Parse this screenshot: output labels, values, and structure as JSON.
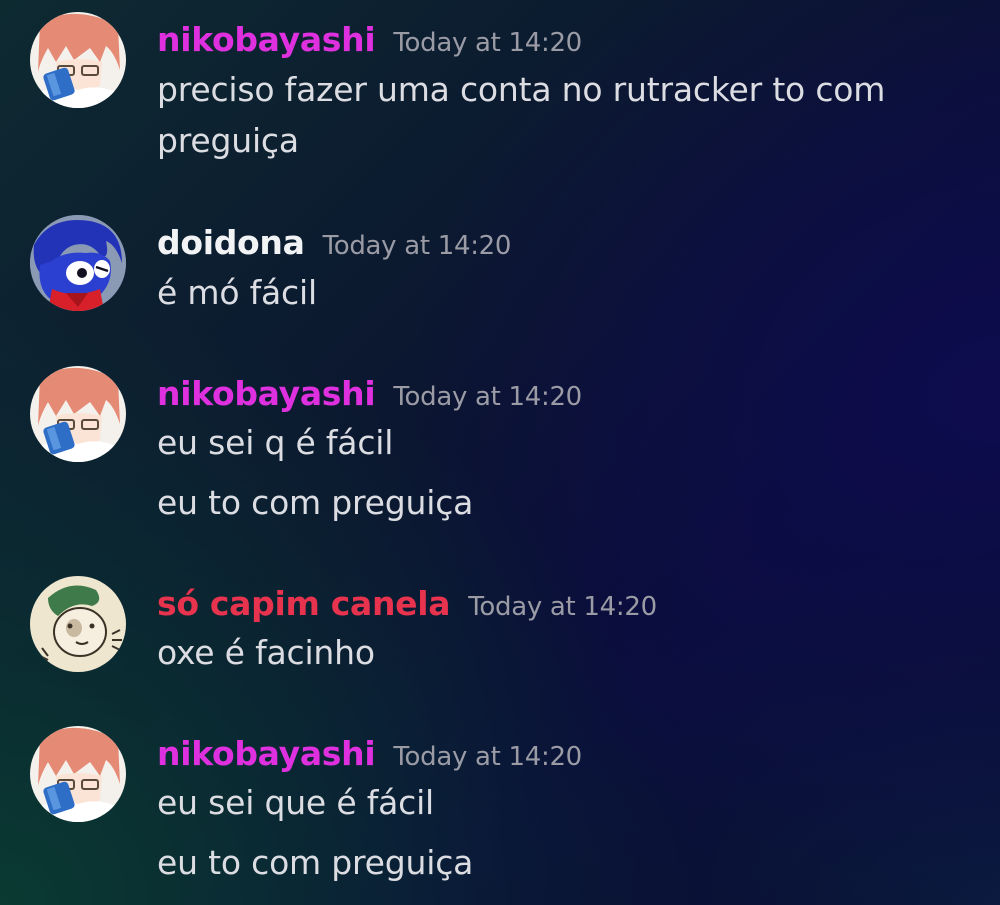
{
  "colors": {
    "niko": "#df30df",
    "doidona": "#f2f3f5",
    "capim": "#e8334f",
    "timestamp": "#9a9ba5",
    "text": "#dcdde2"
  },
  "messages": [
    {
      "username": "nikobayashi",
      "timestamp": "Today at 14:20",
      "lines": [
        "preciso fazer uma conta no rutracker to com",
        "preguiça"
      ]
    },
    {
      "username": "doidona",
      "timestamp": "Today at 14:20",
      "lines": [
        "é mó fácil"
      ]
    },
    {
      "username": "nikobayashi",
      "timestamp": "Today at 14:20",
      "lines": [
        "eu sei q é fácil",
        "eu to com preguiça"
      ]
    },
    {
      "username": "só capim canela",
      "timestamp": "Today at 14:20",
      "lines": [
        "oxe é facinho"
      ]
    },
    {
      "username": "nikobayashi",
      "timestamp": "Today at 14:20",
      "lines": [
        "eu sei que é fácil",
        "eu to com preguiça"
      ]
    }
  ]
}
